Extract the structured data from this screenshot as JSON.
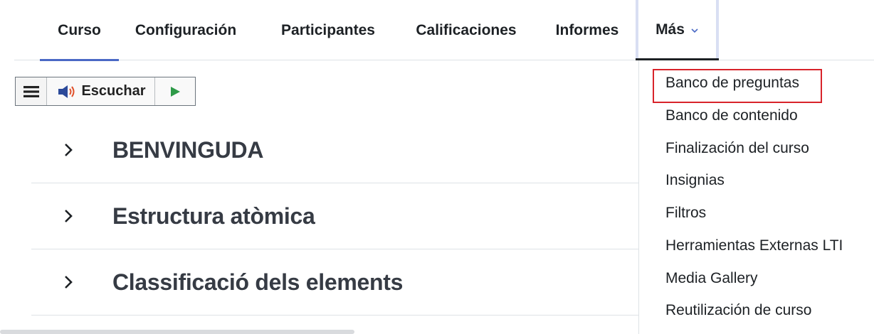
{
  "nav": {
    "tabs": [
      {
        "label": "Curso"
      },
      {
        "label": "Configuración"
      },
      {
        "label": "Participantes"
      },
      {
        "label": "Calificaciones"
      },
      {
        "label": "Informes"
      },
      {
        "label": "Más"
      }
    ],
    "active_tab": "Curso",
    "accent_color": "#4a69c5"
  },
  "reader": {
    "listen_label": "Escuchar",
    "icons": [
      "menu-icon",
      "speaker-icon",
      "play-icon"
    ]
  },
  "sections": [
    {
      "title": "BENVINGUDA"
    },
    {
      "title": "Estructura atòmica"
    },
    {
      "title": "Classificació dels elements"
    }
  ],
  "more_menu": {
    "items": [
      {
        "label": "Banco de preguntas"
      },
      {
        "label": "Banco de contenido"
      },
      {
        "label": "Finalización del curso"
      },
      {
        "label": "Insignias"
      },
      {
        "label": "Filtros"
      },
      {
        "label": "Herramientas Externas LTI"
      },
      {
        "label": "Media Gallery"
      },
      {
        "label": "Reutilización de curso"
      }
    ],
    "highlighted_item": "Banco de preguntas",
    "highlight_color": "#d8232a"
  }
}
